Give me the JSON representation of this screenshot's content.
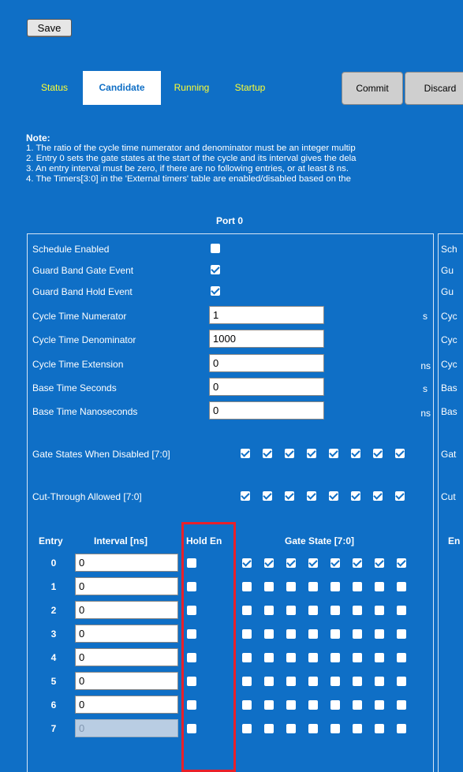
{
  "toolbar": {
    "save_label": "Save"
  },
  "tabs": [
    {
      "label": "Status",
      "active": false
    },
    {
      "label": "Candidate",
      "active": true
    },
    {
      "label": "Running",
      "active": false
    },
    {
      "label": "Startup",
      "active": false
    }
  ],
  "actions": {
    "commit_label": "Commit",
    "discard_label": "Discard"
  },
  "note": {
    "title": "Note:",
    "lines": [
      "1. The ratio of the cycle time numerator and denominator must be an integer multip",
      "2. Entry 0 sets the gate states at the start of the cycle and its interval gives the dela",
      "3. An entry interval must be zero, if there are no following entries, or at least 8 ns.",
      "4. The Timers[3:0] in the 'External timers' table are enabled/disabled based on the"
    ]
  },
  "port": {
    "title": "Port 0",
    "fields": {
      "schedule_enabled": {
        "label": "Schedule Enabled",
        "checked": false
      },
      "guard_band_gate_event": {
        "label": "Guard Band Gate Event",
        "checked": true
      },
      "guard_band_hold_event": {
        "label": "Guard Band Hold Event",
        "checked": true
      },
      "cycle_time_numerator": {
        "label": "Cycle Time Numerator",
        "value": "1",
        "unit": "s"
      },
      "cycle_time_denominator": {
        "label": "Cycle Time Denominator",
        "value": "1000",
        "unit": ""
      },
      "cycle_time_extension": {
        "label": "Cycle Time Extension",
        "value": "0",
        "unit": "ns"
      },
      "base_time_seconds": {
        "label": "Base Time Seconds",
        "value": "0",
        "unit": "s"
      },
      "base_time_nanoseconds": {
        "label": "Base Time Nanoseconds",
        "value": "0",
        "unit": "ns"
      },
      "gate_states_when_disabled": {
        "label": "Gate States When Disabled [7:0]",
        "bits": [
          true,
          true,
          true,
          true,
          true,
          true,
          true,
          true
        ]
      },
      "cut_through_allowed": {
        "label": "Cut-Through Allowed [7:0]",
        "bits": [
          true,
          true,
          true,
          true,
          true,
          true,
          true,
          true
        ]
      }
    },
    "table": {
      "headers": {
        "entry": "Entry",
        "interval": "Interval [ns]",
        "hold_en": "Hold En",
        "gate_state": "Gate State [7:0]"
      },
      "rows": [
        {
          "entry": "0",
          "interval": "0",
          "hold": false,
          "gates": [
            true,
            true,
            true,
            true,
            true,
            true,
            true,
            true
          ],
          "disabled": false
        },
        {
          "entry": "1",
          "interval": "0",
          "hold": false,
          "gates": [
            false,
            false,
            false,
            false,
            false,
            false,
            false,
            false
          ],
          "disabled": false
        },
        {
          "entry": "2",
          "interval": "0",
          "hold": false,
          "gates": [
            false,
            false,
            false,
            false,
            false,
            false,
            false,
            false
          ],
          "disabled": false
        },
        {
          "entry": "3",
          "interval": "0",
          "hold": false,
          "gates": [
            false,
            false,
            false,
            false,
            false,
            false,
            false,
            false
          ],
          "disabled": false
        },
        {
          "entry": "4",
          "interval": "0",
          "hold": false,
          "gates": [
            false,
            false,
            false,
            false,
            false,
            false,
            false,
            false
          ],
          "disabled": false
        },
        {
          "entry": "5",
          "interval": "0",
          "hold": false,
          "gates": [
            false,
            false,
            false,
            false,
            false,
            false,
            false,
            false
          ],
          "disabled": false
        },
        {
          "entry": "6",
          "interval": "0",
          "hold": false,
          "gates": [
            false,
            false,
            false,
            false,
            false,
            false,
            false,
            false
          ],
          "disabled": false
        },
        {
          "entry": "7",
          "interval": "0",
          "hold": false,
          "gates": [
            false,
            false,
            false,
            false,
            false,
            false,
            false,
            false
          ],
          "disabled": true
        }
      ]
    }
  },
  "second_panel_cut_labels": [
    "Sch",
    "Gu",
    "Gu",
    "Cyc",
    "Cyc",
    "Cyc",
    "Bas",
    "Bas",
    "Gat",
    "Cut",
    "En"
  ],
  "colors": {
    "background": "#0f6fc6",
    "tab_text": "#ffff33",
    "highlight": "#e8202a"
  }
}
